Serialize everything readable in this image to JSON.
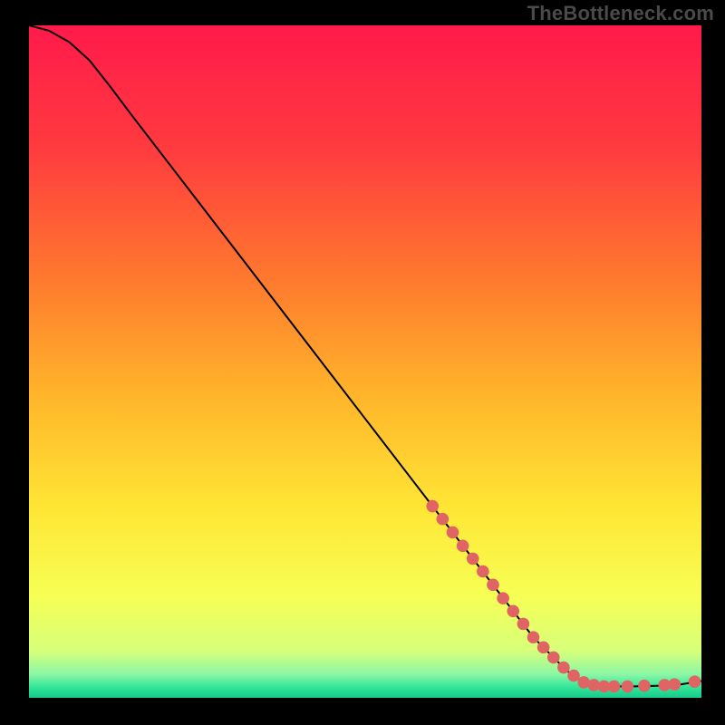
{
  "watermark": "TheBottleneck.com",
  "chart_data": {
    "type": "line",
    "title": "",
    "xlabel": "",
    "ylabel": "",
    "xlim": [
      0,
      100
    ],
    "ylim": [
      0,
      100
    ],
    "gradient_stops": [
      {
        "offset": 0.0,
        "color": "#ff1a4b"
      },
      {
        "offset": 0.18,
        "color": "#ff3a3f"
      },
      {
        "offset": 0.38,
        "color": "#ff7a2e"
      },
      {
        "offset": 0.55,
        "color": "#ffb52a"
      },
      {
        "offset": 0.72,
        "color": "#ffe635"
      },
      {
        "offset": 0.85,
        "color": "#f6ff55"
      },
      {
        "offset": 0.93,
        "color": "#d7ff7a"
      },
      {
        "offset": 0.965,
        "color": "#8cf7a6"
      },
      {
        "offset": 0.985,
        "color": "#2fe598"
      },
      {
        "offset": 1.0,
        "color": "#17c98a"
      }
    ],
    "curve": [
      {
        "x": 0,
        "y": 100.0
      },
      {
        "x": 3,
        "y": 99.2
      },
      {
        "x": 6,
        "y": 97.5
      },
      {
        "x": 9,
        "y": 94.8
      },
      {
        "x": 12,
        "y": 91.0
      },
      {
        "x": 15,
        "y": 87.0
      },
      {
        "x": 20,
        "y": 80.5
      },
      {
        "x": 25,
        "y": 74.0
      },
      {
        "x": 30,
        "y": 67.5
      },
      {
        "x": 35,
        "y": 61.0
      },
      {
        "x": 40,
        "y": 54.5
      },
      {
        "x": 45,
        "y": 48.0
      },
      {
        "x": 50,
        "y": 41.5
      },
      {
        "x": 55,
        "y": 35.0
      },
      {
        "x": 60,
        "y": 28.5
      },
      {
        "x": 65,
        "y": 22.0
      },
      {
        "x": 70,
        "y": 15.5
      },
      {
        "x": 75,
        "y": 9.0
      },
      {
        "x": 80,
        "y": 4.0
      },
      {
        "x": 83,
        "y": 2.0
      },
      {
        "x": 86,
        "y": 1.7
      },
      {
        "x": 90,
        "y": 1.7
      },
      {
        "x": 94,
        "y": 1.8
      },
      {
        "x": 97,
        "y": 2.0
      },
      {
        "x": 100,
        "y": 2.5
      }
    ],
    "marker_color": "#e06464",
    "marker_radius": 6.8,
    "markers": [
      {
        "x": 60.0,
        "y": 28.5
      },
      {
        "x": 61.5,
        "y": 26.6
      },
      {
        "x": 63.0,
        "y": 24.6
      },
      {
        "x": 64.5,
        "y": 22.6
      },
      {
        "x": 66.0,
        "y": 20.7
      },
      {
        "x": 67.5,
        "y": 18.8
      },
      {
        "x": 69.0,
        "y": 16.8
      },
      {
        "x": 70.5,
        "y": 14.8
      },
      {
        "x": 72.0,
        "y": 12.9
      },
      {
        "x": 73.5,
        "y": 11.0
      },
      {
        "x": 75.0,
        "y": 9.0
      },
      {
        "x": 76.5,
        "y": 7.5
      },
      {
        "x": 78.0,
        "y": 6.0
      },
      {
        "x": 79.5,
        "y": 4.5
      },
      {
        "x": 81.0,
        "y": 3.3
      },
      {
        "x": 82.5,
        "y": 2.3
      },
      {
        "x": 84.0,
        "y": 1.9
      },
      {
        "x": 85.5,
        "y": 1.7
      },
      {
        "x": 87.0,
        "y": 1.7
      },
      {
        "x": 89.0,
        "y": 1.7
      },
      {
        "x": 91.5,
        "y": 1.8
      },
      {
        "x": 94.5,
        "y": 1.9
      },
      {
        "x": 96.0,
        "y": 2.0
      },
      {
        "x": 99.0,
        "y": 2.4
      }
    ]
  }
}
